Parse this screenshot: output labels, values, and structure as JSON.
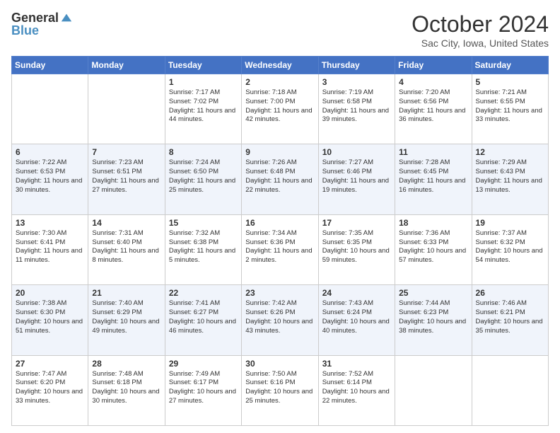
{
  "header": {
    "logo_line1": "General",
    "logo_line2": "Blue",
    "month_title": "October 2024",
    "subtitle": "Sac City, Iowa, United States"
  },
  "weekdays": [
    "Sunday",
    "Monday",
    "Tuesday",
    "Wednesday",
    "Thursday",
    "Friday",
    "Saturday"
  ],
  "weeks": [
    [
      {
        "day": "",
        "sunrise": "",
        "sunset": "",
        "daylight": ""
      },
      {
        "day": "",
        "sunrise": "",
        "sunset": "",
        "daylight": ""
      },
      {
        "day": "1",
        "sunrise": "Sunrise: 7:17 AM",
        "sunset": "Sunset: 7:02 PM",
        "daylight": "Daylight: 11 hours and 44 minutes."
      },
      {
        "day": "2",
        "sunrise": "Sunrise: 7:18 AM",
        "sunset": "Sunset: 7:00 PM",
        "daylight": "Daylight: 11 hours and 42 minutes."
      },
      {
        "day": "3",
        "sunrise": "Sunrise: 7:19 AM",
        "sunset": "Sunset: 6:58 PM",
        "daylight": "Daylight: 11 hours and 39 minutes."
      },
      {
        "day": "4",
        "sunrise": "Sunrise: 7:20 AM",
        "sunset": "Sunset: 6:56 PM",
        "daylight": "Daylight: 11 hours and 36 minutes."
      },
      {
        "day": "5",
        "sunrise": "Sunrise: 7:21 AM",
        "sunset": "Sunset: 6:55 PM",
        "daylight": "Daylight: 11 hours and 33 minutes."
      }
    ],
    [
      {
        "day": "6",
        "sunrise": "Sunrise: 7:22 AM",
        "sunset": "Sunset: 6:53 PM",
        "daylight": "Daylight: 11 hours and 30 minutes."
      },
      {
        "day": "7",
        "sunrise": "Sunrise: 7:23 AM",
        "sunset": "Sunset: 6:51 PM",
        "daylight": "Daylight: 11 hours and 27 minutes."
      },
      {
        "day": "8",
        "sunrise": "Sunrise: 7:24 AM",
        "sunset": "Sunset: 6:50 PM",
        "daylight": "Daylight: 11 hours and 25 minutes."
      },
      {
        "day": "9",
        "sunrise": "Sunrise: 7:26 AM",
        "sunset": "Sunset: 6:48 PM",
        "daylight": "Daylight: 11 hours and 22 minutes."
      },
      {
        "day": "10",
        "sunrise": "Sunrise: 7:27 AM",
        "sunset": "Sunset: 6:46 PM",
        "daylight": "Daylight: 11 hours and 19 minutes."
      },
      {
        "day": "11",
        "sunrise": "Sunrise: 7:28 AM",
        "sunset": "Sunset: 6:45 PM",
        "daylight": "Daylight: 11 hours and 16 minutes."
      },
      {
        "day": "12",
        "sunrise": "Sunrise: 7:29 AM",
        "sunset": "Sunset: 6:43 PM",
        "daylight": "Daylight: 11 hours and 13 minutes."
      }
    ],
    [
      {
        "day": "13",
        "sunrise": "Sunrise: 7:30 AM",
        "sunset": "Sunset: 6:41 PM",
        "daylight": "Daylight: 11 hours and 11 minutes."
      },
      {
        "day": "14",
        "sunrise": "Sunrise: 7:31 AM",
        "sunset": "Sunset: 6:40 PM",
        "daylight": "Daylight: 11 hours and 8 minutes."
      },
      {
        "day": "15",
        "sunrise": "Sunrise: 7:32 AM",
        "sunset": "Sunset: 6:38 PM",
        "daylight": "Daylight: 11 hours and 5 minutes."
      },
      {
        "day": "16",
        "sunrise": "Sunrise: 7:34 AM",
        "sunset": "Sunset: 6:36 PM",
        "daylight": "Daylight: 11 hours and 2 minutes."
      },
      {
        "day": "17",
        "sunrise": "Sunrise: 7:35 AM",
        "sunset": "Sunset: 6:35 PM",
        "daylight": "Daylight: 10 hours and 59 minutes."
      },
      {
        "day": "18",
        "sunrise": "Sunrise: 7:36 AM",
        "sunset": "Sunset: 6:33 PM",
        "daylight": "Daylight: 10 hours and 57 minutes."
      },
      {
        "day": "19",
        "sunrise": "Sunrise: 7:37 AM",
        "sunset": "Sunset: 6:32 PM",
        "daylight": "Daylight: 10 hours and 54 minutes."
      }
    ],
    [
      {
        "day": "20",
        "sunrise": "Sunrise: 7:38 AM",
        "sunset": "Sunset: 6:30 PM",
        "daylight": "Daylight: 10 hours and 51 minutes."
      },
      {
        "day": "21",
        "sunrise": "Sunrise: 7:40 AM",
        "sunset": "Sunset: 6:29 PM",
        "daylight": "Daylight: 10 hours and 49 minutes."
      },
      {
        "day": "22",
        "sunrise": "Sunrise: 7:41 AM",
        "sunset": "Sunset: 6:27 PM",
        "daylight": "Daylight: 10 hours and 46 minutes."
      },
      {
        "day": "23",
        "sunrise": "Sunrise: 7:42 AM",
        "sunset": "Sunset: 6:26 PM",
        "daylight": "Daylight: 10 hours and 43 minutes."
      },
      {
        "day": "24",
        "sunrise": "Sunrise: 7:43 AM",
        "sunset": "Sunset: 6:24 PM",
        "daylight": "Daylight: 10 hours and 40 minutes."
      },
      {
        "day": "25",
        "sunrise": "Sunrise: 7:44 AM",
        "sunset": "Sunset: 6:23 PM",
        "daylight": "Daylight: 10 hours and 38 minutes."
      },
      {
        "day": "26",
        "sunrise": "Sunrise: 7:46 AM",
        "sunset": "Sunset: 6:21 PM",
        "daylight": "Daylight: 10 hours and 35 minutes."
      }
    ],
    [
      {
        "day": "27",
        "sunrise": "Sunrise: 7:47 AM",
        "sunset": "Sunset: 6:20 PM",
        "daylight": "Daylight: 10 hours and 33 minutes."
      },
      {
        "day": "28",
        "sunrise": "Sunrise: 7:48 AM",
        "sunset": "Sunset: 6:18 PM",
        "daylight": "Daylight: 10 hours and 30 minutes."
      },
      {
        "day": "29",
        "sunrise": "Sunrise: 7:49 AM",
        "sunset": "Sunset: 6:17 PM",
        "daylight": "Daylight: 10 hours and 27 minutes."
      },
      {
        "day": "30",
        "sunrise": "Sunrise: 7:50 AM",
        "sunset": "Sunset: 6:16 PM",
        "daylight": "Daylight: 10 hours and 25 minutes."
      },
      {
        "day": "31",
        "sunrise": "Sunrise: 7:52 AM",
        "sunset": "Sunset: 6:14 PM",
        "daylight": "Daylight: 10 hours and 22 minutes."
      },
      {
        "day": "",
        "sunrise": "",
        "sunset": "",
        "daylight": ""
      },
      {
        "day": "",
        "sunrise": "",
        "sunset": "",
        "daylight": ""
      }
    ]
  ]
}
